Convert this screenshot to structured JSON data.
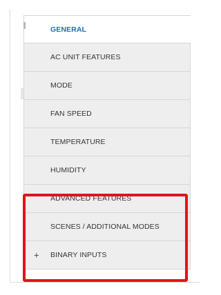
{
  "menu": {
    "items": [
      {
        "label": "GENERAL",
        "active": true
      },
      {
        "label": "AC UNIT FEATURES"
      },
      {
        "label": "MODE"
      },
      {
        "label": "FAN SPEED"
      },
      {
        "label": "TEMPERATURE"
      },
      {
        "label": "HUMIDITY"
      },
      {
        "label": "ADVANCED FEATURES"
      },
      {
        "label": "SCENES / ADDITIONAL MODES"
      },
      {
        "label": "BINARY INPUTS",
        "expander": "+"
      }
    ]
  },
  "colors": {
    "active_text": "#1f6fb8",
    "item_bg": "#eeeeee",
    "highlight": "#e3121b"
  }
}
